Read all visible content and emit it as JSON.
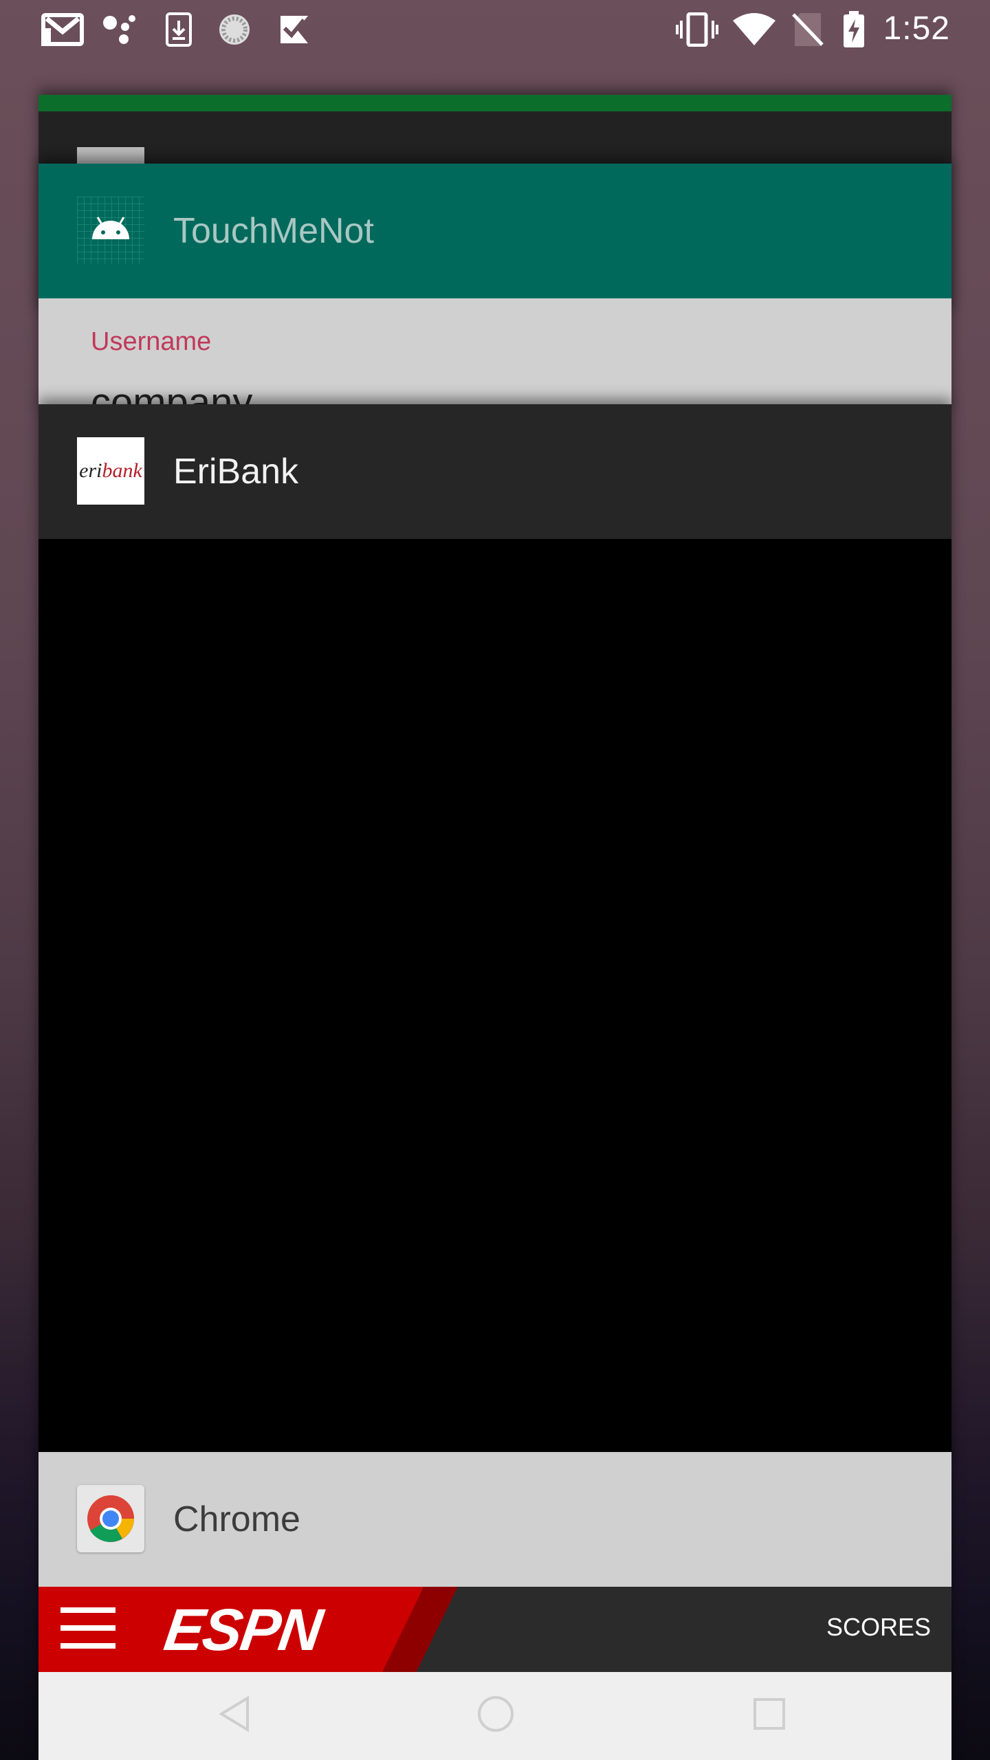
{
  "status_bar": {
    "time": "1:52",
    "left_icons": [
      "gmail-icon",
      "assistant-icon",
      "download-icon",
      "loading-icon",
      "check-flag-icon"
    ],
    "right_icons": [
      "vibrate-icon",
      "wifi-icon",
      "no-sim-icon",
      "battery-charging-icon"
    ]
  },
  "recents": {
    "cards": [
      {
        "app": "TouchMeNot",
        "icon": "android-icon",
        "header_color": "#00695c",
        "preview": {
          "label": "Username",
          "value": "company"
        }
      },
      {
        "app": "EriBank",
        "icon": "eribank-logo",
        "header_color": "#262626",
        "logo": {
          "part1": "eri",
          "part2": "bank"
        }
      },
      {
        "app": "Chrome",
        "icon": "chrome-icon",
        "header_color": "#d0d0d0",
        "preview": {
          "site_logo": "ESPN",
          "link": "SCORES"
        }
      }
    ]
  },
  "colors": {
    "espn_red": "#cc0000",
    "touchmenot_teal": "#00695c",
    "accent_green": "#0b6e2a"
  }
}
